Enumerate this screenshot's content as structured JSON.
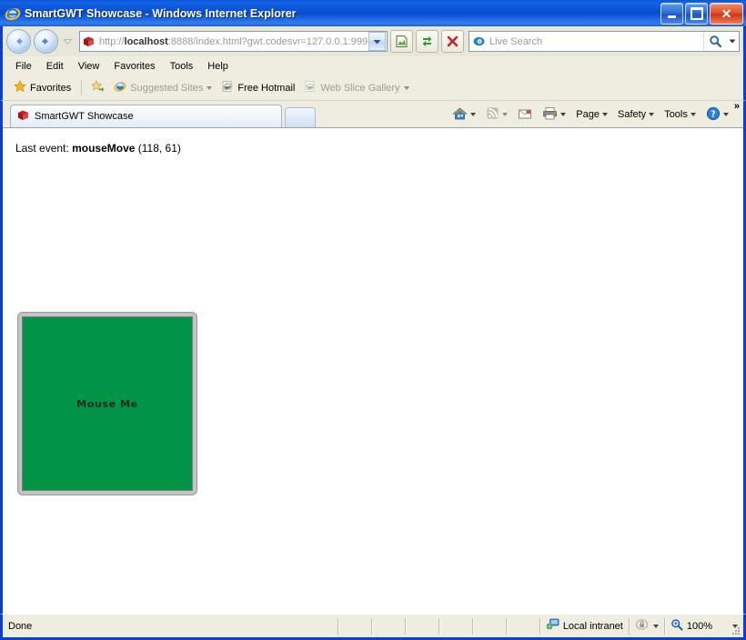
{
  "window": {
    "title": "SmartGWT Showcase - Windows Internet Explorer",
    "app_icon": "internet-explorer-icon",
    "minimize_label": "_",
    "maximize_label": "❑",
    "close_label": "✕"
  },
  "navbar": {
    "back_label": "Back",
    "forward_label": "Forward",
    "recent_pages_label": "Recent Pages",
    "address_icon": "red-cube-favicon",
    "address_value": "http://localhost:8888/index.html?gwt.codesvr=127.0.0.1:999",
    "address_host": "localhost",
    "address_prefix": "http://",
    "address_suffix": ":8888/index.html?gwt.codesvr=127.0.0.1:999",
    "compat_view_label": "Compatibility View",
    "refresh_label": "Refresh",
    "stop_label": "Stop",
    "search_placeholder": "Live Search",
    "search_value": "",
    "search_provider_icon": "bing-icon",
    "search_go_label": "Search"
  },
  "menubar": {
    "items": [
      {
        "label": "File"
      },
      {
        "label": "Edit"
      },
      {
        "label": "View"
      },
      {
        "label": "Favorites"
      },
      {
        "label": "Tools"
      },
      {
        "label": "Help"
      }
    ]
  },
  "favoritesbar": {
    "favorites_label": "Favorites",
    "items": [
      {
        "label": "Suggested Sites",
        "icon": "ie-page-icon",
        "dimmed": true,
        "has_caret": true
      },
      {
        "label": "Free Hotmail",
        "icon": "ie-page-icon",
        "dimmed": false,
        "has_caret": false
      },
      {
        "label": "Web Slice Gallery",
        "icon": "ie-page-icon",
        "dimmed": true,
        "has_caret": true
      }
    ]
  },
  "tabbar": {
    "tabs": [
      {
        "label": "SmartGWT Showcase",
        "icon": "red-cube-favicon",
        "active": true
      }
    ],
    "new_tab_label": "New Tab"
  },
  "commandbar": {
    "home_label": "Home",
    "feeds_label": "Feeds",
    "mail_label": "Read Mail",
    "print_label": "Print",
    "page_label": "Page",
    "safety_label": "Safety",
    "tools_label": "Tools",
    "help_label": "Help",
    "overflow_label": "»"
  },
  "page": {
    "last_event_prefix": "Last event:",
    "last_event_name": "mouseMove",
    "last_event_coords": "(118, 61)",
    "mouse_box_label": "Mouse Me",
    "mouse_box_color": "#009447",
    "mouse_box_border_color": "#c3c3c3"
  },
  "statusbar": {
    "status_text": "Done",
    "zone_label": "Local intranet",
    "zone_icon": "intranet-globe-icon",
    "protected_mode_icon": "lock-icon",
    "zoom_label": "100%",
    "zoom_icon": "magnifier-icon"
  }
}
